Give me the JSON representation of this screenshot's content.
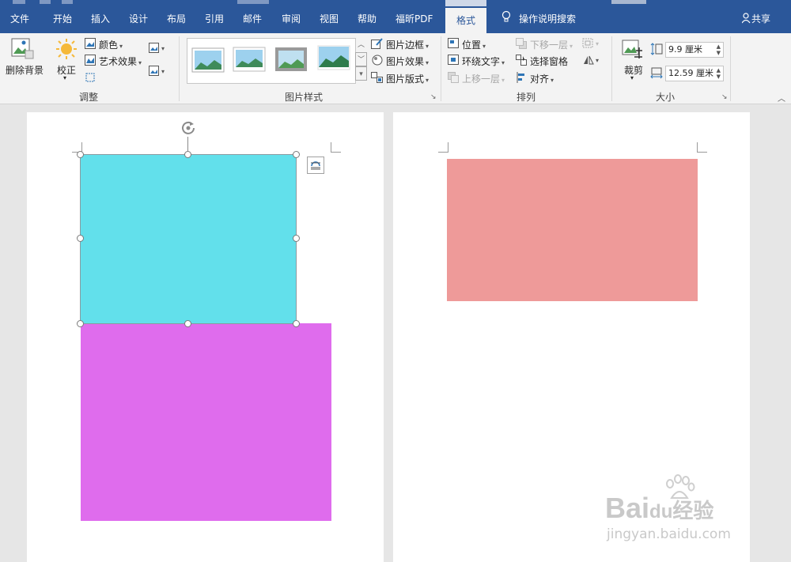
{
  "tabs": {
    "file": "文件",
    "home": "开始",
    "insert": "插入",
    "design": "设计",
    "layout": "布局",
    "references": "引用",
    "mailings": "邮件",
    "review": "审阅",
    "view": "视图",
    "help": "帮助",
    "foxit_pdf": "福昕PDF",
    "format": "格式",
    "tell_me": "操作说明搜索",
    "share": "共享"
  },
  "ribbon": {
    "adjust": {
      "remove_bg": "删除背景",
      "corrections": "校正",
      "color": "颜色",
      "artistic_effects": "艺术效果",
      "group_label": "调整"
    },
    "picture_styles": {
      "border": "图片边框",
      "effects": "图片效果",
      "layout": "图片版式",
      "group_label": "图片样式"
    },
    "arrange": {
      "position": "位置",
      "wrap_text": "环绕文字",
      "bring_forward": "上移一层",
      "send_backward": "下移一层",
      "selection_pane": "选择窗格",
      "align": "对齐",
      "group_label": "排列"
    },
    "size": {
      "crop": "裁剪",
      "height": "9.9 厘米",
      "width": "12.59 厘米",
      "group_label": "大小"
    }
  },
  "document": {
    "shape_colors": {
      "selected_cyan": "#62e0eb",
      "magenta": "#df6ced",
      "salmon": "#ee9a99"
    }
  },
  "watermark": {
    "brand": "Bai",
    "brand_suffix": "du",
    "cn": "经验",
    "url": "jingyan.baidu.com"
  }
}
